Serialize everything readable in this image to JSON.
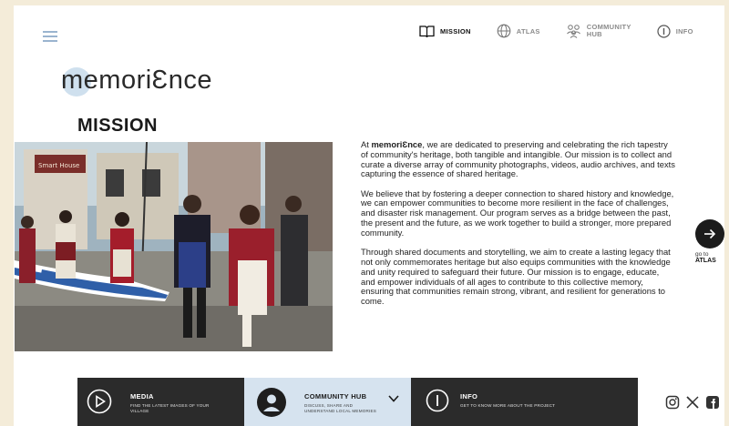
{
  "nav": {
    "items": [
      {
        "label": "MISSION",
        "icon": "book-icon",
        "active": true
      },
      {
        "label": "ATLAS",
        "icon": "globe-icon",
        "active": false
      },
      {
        "label_line1": "COMMUNITY",
        "label_line2": "HUB",
        "icon": "people-icon",
        "active": false
      },
      {
        "label": "INFO",
        "icon": "info-icon",
        "active": false
      }
    ]
  },
  "logo": {
    "text": "memoriƐnce"
  },
  "page_title": "MISSION",
  "mission": {
    "p1_brand": "memoriƐnce",
    "p1_before": "At ",
    "p1_after": ", we are dedicated to preserving and celebrating the rich tapestry of community's heritage, both tangible and intangible. Our mission is to collect and curate a diverse array of community photographs, videos, audio archives, and texts capturing the essence of shared heritage.",
    "p2": "We believe that by fostering a deeper connection to shared history and knowledge, we can empower communities to become more resilient in the face of challenges, and disaster risk management. Our program serves as a bridge between the past, the present and the future, as we work together to build a stronger, more prepared community.",
    "p3": "Through shared documents and storytelling, we aim to create a lasting legacy that not only commemorates heritage but also equips communities with the knowledge and unity required to safeguard their future. Our mission is to engage, educate, and empower individuals of all ages to contribute to this collective memory, ensuring that communities remain strong, vibrant, and resilient for generations to come."
  },
  "goto": {
    "line1": "go to",
    "line2": "ATLAS"
  },
  "bottom": {
    "media": {
      "title": "MEDIA",
      "sub1": "FIND THE LATEST IMAGES OF YOUR",
      "sub2": "VILLAGE"
    },
    "hub": {
      "title": "COMMUNITY HUB",
      "sub1": "DISCUSS, SHARE AND",
      "sub2": "UNDERSTAND LOCAL MEMORIES"
    },
    "info": {
      "title": "INFO",
      "sub1": "GET TO KNOW MORE ABOUT THE PROJECT"
    }
  },
  "social": [
    "instagram-icon",
    "x-icon",
    "facebook-icon"
  ],
  "colors": {
    "background": "#f4ecd9",
    "accent_light": "#d6e3ef",
    "dark": "#2b2b2b"
  }
}
